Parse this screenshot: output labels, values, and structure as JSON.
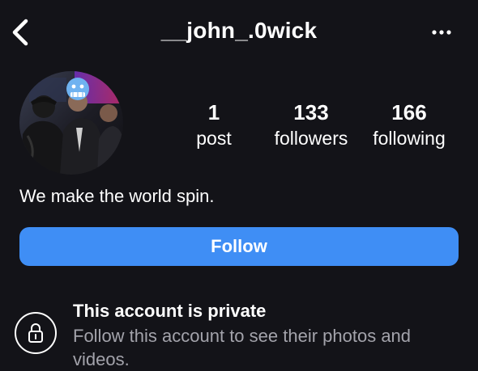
{
  "header": {
    "username": "__john_.0wick",
    "back_icon": "chevron-left-icon",
    "more_icon": "ellipsis-icon"
  },
  "profile": {
    "avatar": "profile-photo",
    "stats": [
      {
        "value": "1",
        "label": "post"
      },
      {
        "value": "133",
        "label": "followers"
      },
      {
        "value": "166",
        "label": "following"
      }
    ],
    "bio": "We make the world spin."
  },
  "actions": {
    "follow_label": "Follow"
  },
  "private_notice": {
    "icon": "lock-icon",
    "title": "This account is private",
    "description": "Follow this account to see their photos and videos."
  },
  "colors": {
    "background": "#131318",
    "accent": "#3f8ef5",
    "secondary_text": "#a3a3ab"
  }
}
